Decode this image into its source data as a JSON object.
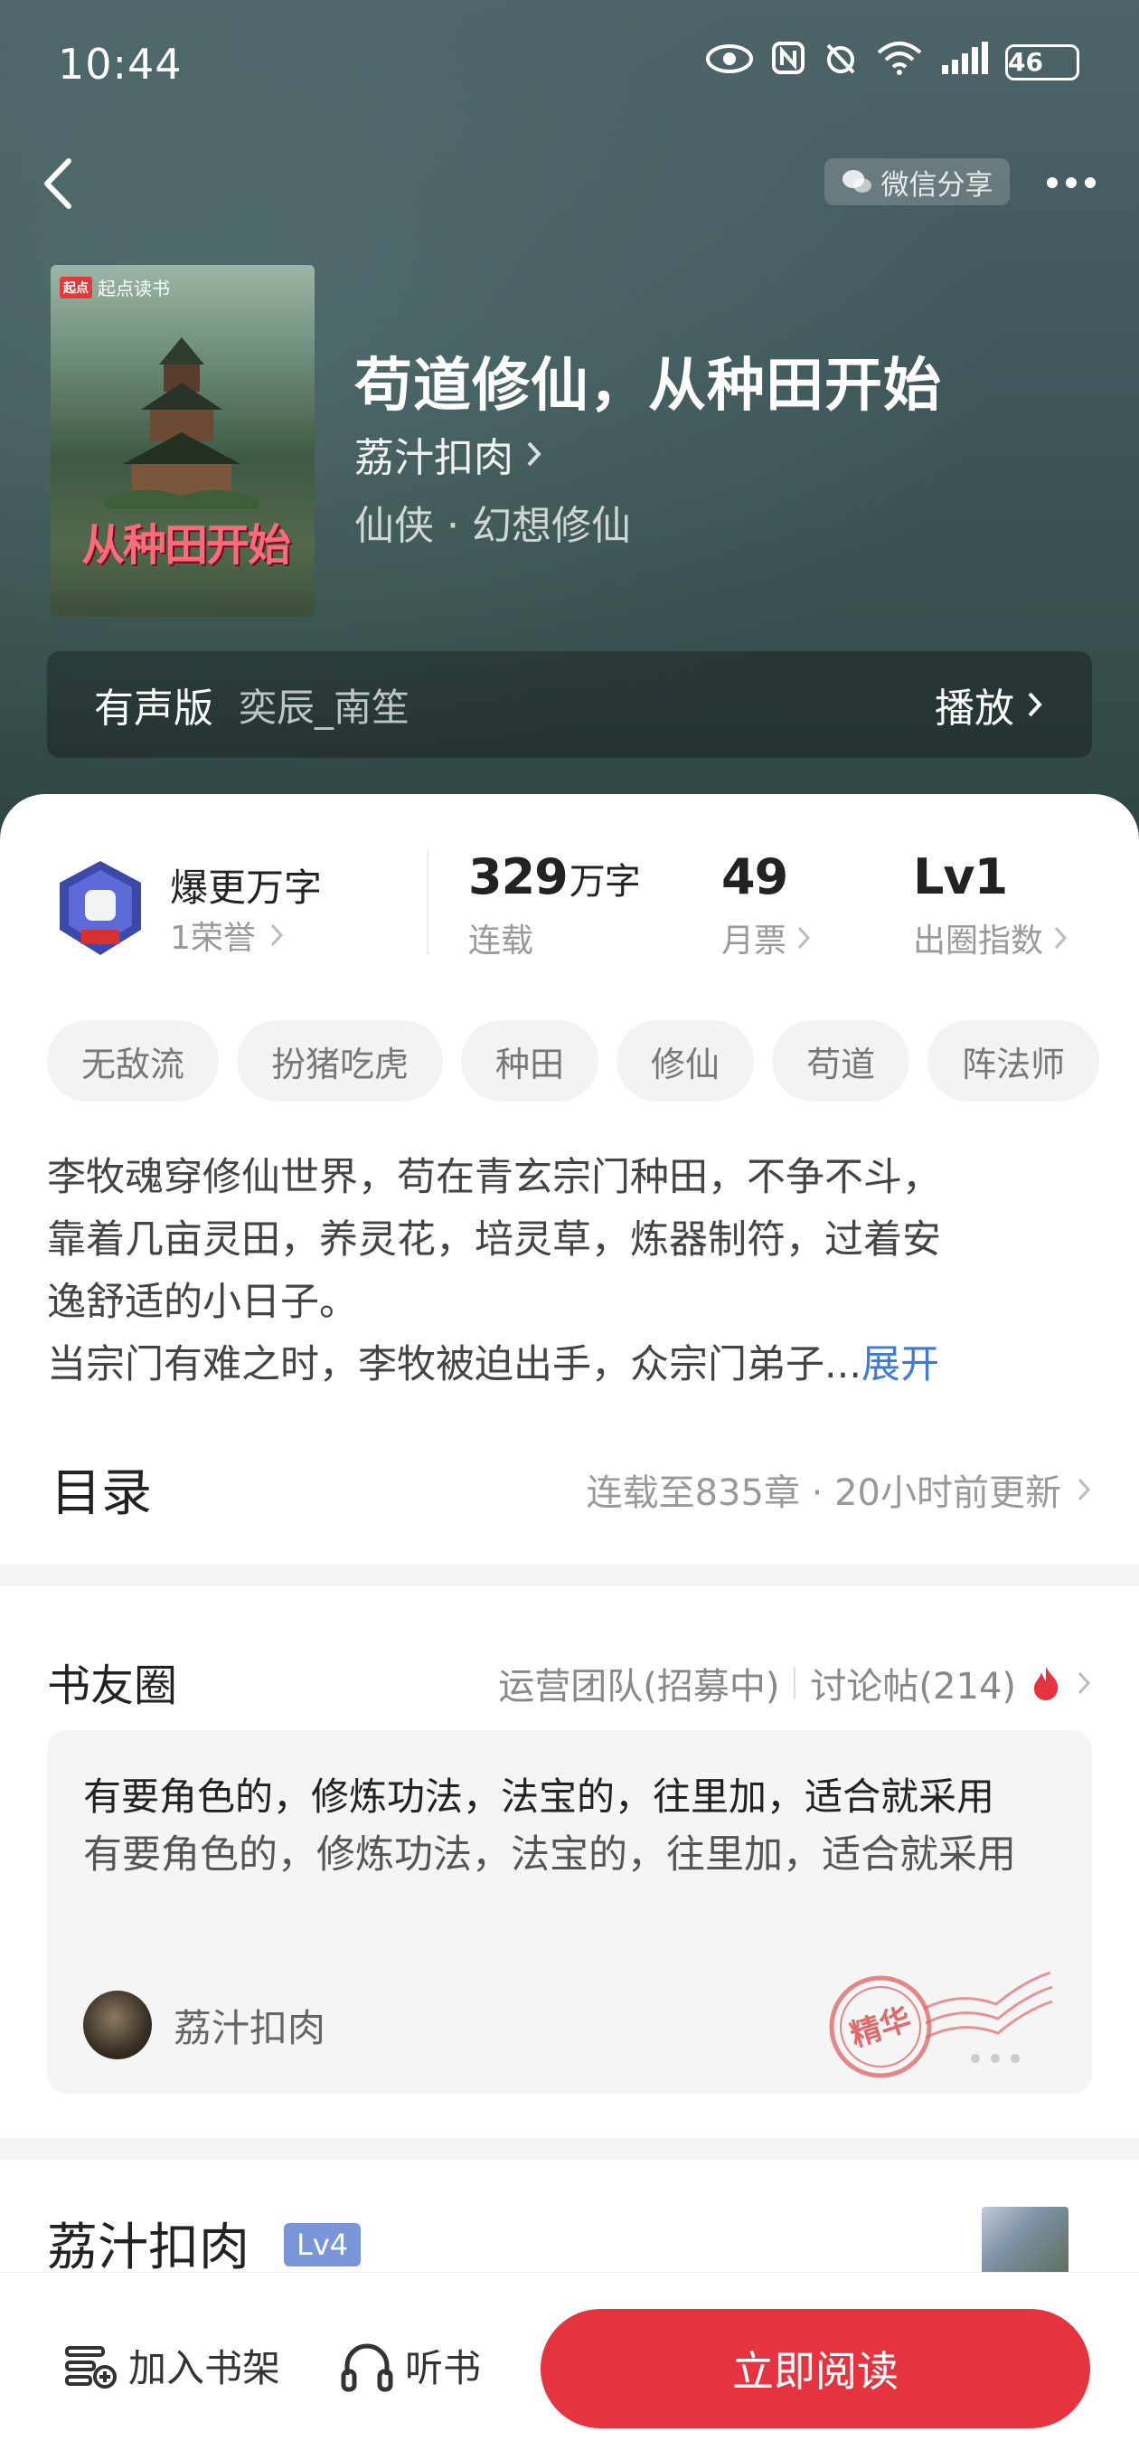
{
  "status_bar": {
    "time": "10:44",
    "battery": "46"
  },
  "header": {
    "share_label": "微信分享",
    "back_icon": "chevron-left-icon",
    "more_icon": "more-dots-icon"
  },
  "book": {
    "cover_logo": "起点读书",
    "cover_title": "从种田开始",
    "title": "苟道修仙，从种田开始",
    "author": "荔汁扣肉",
    "genre": "仙侠 · 幻想修仙"
  },
  "audio": {
    "label": "有声版",
    "narrator": "奕辰_南笙",
    "play_label": "播放"
  },
  "stats": {
    "honor_title": "爆更万字",
    "honor_sub": "1荣誉",
    "words_num": "329",
    "words_unit": "万字",
    "words_label": "连载",
    "tickets_num": "49",
    "tickets_label": "月票",
    "level_num": "Lv1",
    "level_label": "出圈指数"
  },
  "tags": [
    "无敌流",
    "扮猪吃虎",
    "种田",
    "修仙",
    "苟道",
    "阵法师"
  ],
  "synopsis": {
    "line1": "李牧魂穿修仙世界，苟在青玄宗门种田，不争不斗，",
    "line2": "靠着几亩灵田，养灵花，培灵草，炼器制符，过着安",
    "line3": "逸舒适的小日子。",
    "line4": "当宗门有难之时，李牧被迫出手，众宗门弟子...",
    "expand": "展开"
  },
  "toc": {
    "title": "目录",
    "info": "连载至835章 · 20小时前更新"
  },
  "circle": {
    "title": "书友圈",
    "team": "运营团队(招募中)",
    "posts": "讨论帖(214)",
    "post_title": "有要角色的，修炼功法，法宝的，往里加，适合就采用",
    "post_body": "有要角色的，修炼功法，法宝的，往里加，适合就采用",
    "post_author": "荔汁扣肉",
    "stamp_text": "精华"
  },
  "author_section": {
    "name": "荔汁扣肉",
    "level": "Lv4"
  },
  "bottom_bar": {
    "shelf_label": "加入书架",
    "listen_label": "听书",
    "read_label": "立即阅读"
  },
  "colors": {
    "accent_red": "#e5333f",
    "link_blue": "#3f7ad6",
    "level_badge": "#7a96d6"
  }
}
